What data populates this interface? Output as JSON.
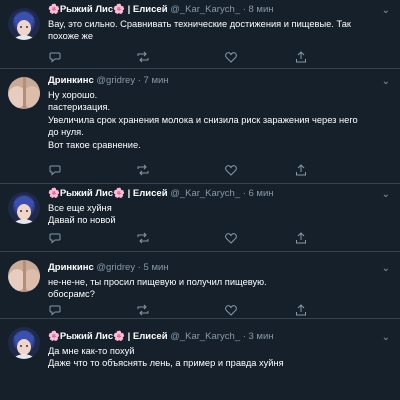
{
  "tweets": [
    {
      "name": "Рыжий Лис",
      "flower": "🌸",
      "affiliation": "| Елисей",
      "handle": "@_Kar_Karych_",
      "dot": "·",
      "time": "8 мин",
      "text_lines": [
        "Вау, это сильно. Сравнивать технические достижения и пищевые. Так",
        "похоже же"
      ],
      "actions": [
        "reply-icon",
        "retweet-icon",
        "like-icon",
        "share-icon"
      ]
    },
    {
      "name": "Дринкинс",
      "handle": "@gridrey",
      "dot": "·",
      "time": "7 мин",
      "text_lines": [
        "Ну хорошо.",
        "пастеризация.",
        "Увеличила срок хранения молока и снизила риск заражения через него",
        "до нуля.",
        "Вот такое сравнение."
      ],
      "actions": [
        "reply-icon",
        "retweet-icon",
        "like-icon",
        "share-icon"
      ]
    },
    {
      "name": "Рыжий Лис",
      "flower": "🌸",
      "affiliation": "| Елисей",
      "handle": "@_Kar_Karych_",
      "dot": "·",
      "time": "6 мин",
      "text_lines": [
        "Все еще хуйня",
        "Давай по новой"
      ],
      "actions": [
        "reply-icon",
        "retweet-icon",
        "like-icon",
        "share-icon"
      ]
    },
    {
      "name": "Дринкинс",
      "handle": "@gridrey",
      "dot": "·",
      "time": "5 мин",
      "text_lines": [
        "не-не-не, ты просил пищевую и получил пищевую.",
        "обосрамс?"
      ],
      "actions": [
        "reply-icon",
        "retweet-icon",
        "like-icon",
        "share-icon"
      ]
    },
    {
      "name": "Рыжий Лис",
      "flower": "🌸",
      "affiliation": "| Елисей",
      "handle": "@_Kar_Karych_",
      "dot": "·",
      "time": "3 мин",
      "text_lines": [
        "Да мне как-то похуй",
        "Даже что то объяснять лень, а пример и правда хуйня"
      ]
    }
  ],
  "colors": {
    "background": "#15202b",
    "separator": "#38444d",
    "secondary_text": "#8899a6",
    "flower": "#e35d9b"
  }
}
